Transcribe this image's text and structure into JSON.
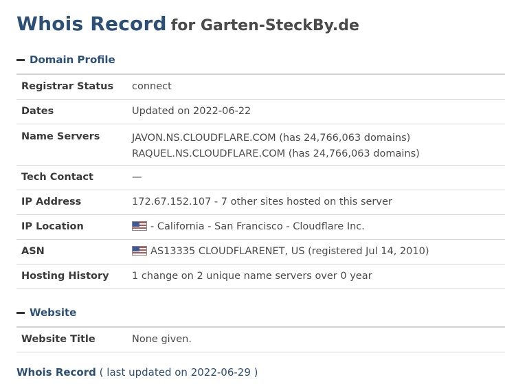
{
  "title": {
    "main": "Whois Record",
    "sub": "for Garten-SteckBy.de"
  },
  "domain_profile": {
    "heading": "Domain Profile",
    "rows": {
      "registrar_status": {
        "label": "Registrar Status",
        "value": "connect"
      },
      "dates": {
        "label": "Dates",
        "value": "Updated on 2022-06-22"
      },
      "name_servers": {
        "label": "Name Servers",
        "line1": "JAVON.NS.CLOUDFLARE.COM (has 24,766,063 domains)",
        "line2": "RAQUEL.NS.CLOUDFLARE.COM (has 24,766,063 domains)"
      },
      "tech_contact": {
        "label": "Tech Contact",
        "value": "—"
      },
      "ip_address": {
        "label": "IP Address",
        "value": "172.67.152.107 - 7 other sites hosted on this server"
      },
      "ip_location": {
        "label": "IP Location",
        "value": "- California - San Francisco - Cloudflare Inc.",
        "flag_icon": "us-flag-icon"
      },
      "asn": {
        "label": "ASN",
        "value": "AS13335 CLOUDFLARENET, US (registered Jul 14, 2010)",
        "flag_icon": "us-flag-icon"
      },
      "hosting_history": {
        "label": "Hosting History",
        "value": "1 change on 2 unique name servers over 0 year"
      }
    }
  },
  "website": {
    "heading": "Website",
    "rows": {
      "website_title": {
        "label": "Website Title",
        "value": "None given."
      }
    }
  },
  "footer": {
    "link": "Whois Record",
    "note": "( last updated on 2022-06-29 )"
  },
  "colors": {
    "heading_blue": "#2c4f75",
    "text": "#4a4a4a",
    "divider": "#d6d6d6"
  }
}
